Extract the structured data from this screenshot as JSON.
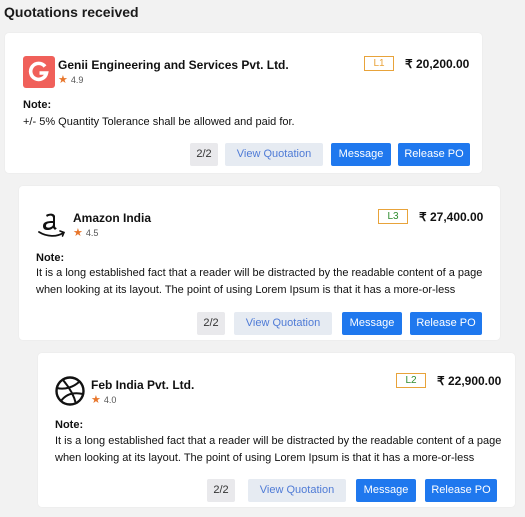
{
  "page": {
    "title": "Quotations received"
  },
  "quotations": [
    {
      "vendor": "Genii Engineering and Services Pvt. Ltd.",
      "logo_icon": "genii-g-logo-icon",
      "rating": "4.9",
      "rank": "L1",
      "rank_color": "#e8a33a",
      "price": "₹ 20,200.00",
      "note_label": "Note:",
      "note": "+/- 5% Quantity Tolerance shall be allowed and paid for.",
      "page_count": "2/2",
      "view_label": "View Quotation",
      "message_label": "Message",
      "release_label": "Release PO"
    },
    {
      "vendor": "Amazon India",
      "logo_icon": "amazon-logo-icon",
      "rating": "4.5",
      "rank": "L3",
      "rank_color": "#2e8b2e",
      "price": "₹ 27,400.00",
      "note_label": "Note:",
      "note_line1": "It is a long established fact that a reader will be distracted by the readable content of a page",
      "note_line2": "when looking at its layout. The point of using Lorem Ipsum is that it has a more-or-less",
      "page_count": "2/2",
      "view_label": "View Quotation",
      "message_label": "Message",
      "release_label": "Release PO"
    },
    {
      "vendor": "Feb India Pvt. Ltd.",
      "logo_icon": "dribbble-ball-logo-icon",
      "rating": "4.0",
      "rank": "L2",
      "rank_color": "#2e8b2e",
      "price": "₹ 22,900.00",
      "note_label": "Note:",
      "note_line1": "It is a long established fact that a reader will be distracted by the readable content of a page",
      "note_line2": "when looking at its layout. The point of using Lorem Ipsum is that it has a more-or-less",
      "page_count": "2/2",
      "view_label": "View Quotation",
      "message_label": "Message",
      "release_label": "Release PO"
    }
  ],
  "colors": {
    "primary_button": "#1f78ee",
    "star": "#e8762b",
    "genii_red": "#f0605a"
  }
}
